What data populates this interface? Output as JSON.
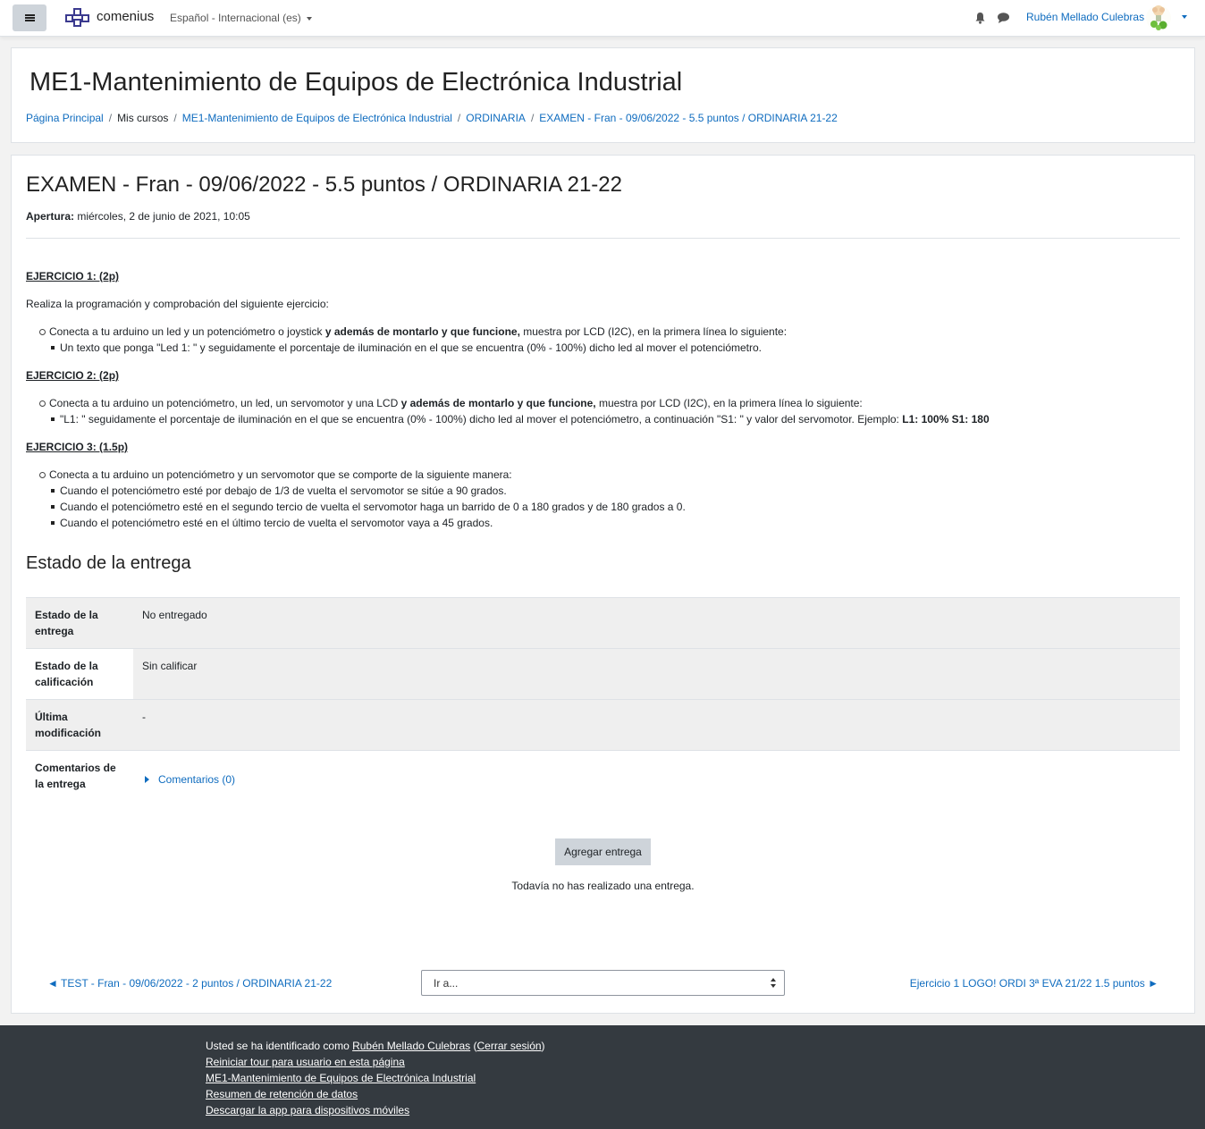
{
  "navbar": {
    "brand": "comenius",
    "language": "Español - Internacional (es)",
    "user_name": "Rubén Mellado Culebras"
  },
  "header": {
    "course_title": "ME1-Mantenimiento de Equipos de Electrónica Industrial",
    "breadcrumb": [
      "Página Principal",
      "Mis cursos",
      "ME1-Mantenimiento de Equipos de Electrónica Industrial",
      "ORDINARIA",
      "EXAMEN - Fran - 09/06/2022 - 5.5 puntos / ORDINARIA 21-22"
    ]
  },
  "assignment": {
    "title": "EXAMEN - Fran - 09/06/2022 - 5.5 puntos / ORDINARIA 21-22",
    "opening_label": "Apertura:",
    "opening_value": " miércoles, 2 de junio de 2021, 10:05",
    "ex1": {
      "heading_a": "EJERCICIO 1: ",
      "heading_b": "(2p)",
      "intro": "Realiza la programación y comprobación del siguiente ejercicio:",
      "item_a": "Conecta a tu arduino un led y un potenciómetro o joystick ",
      "item_b": "y además de montarlo y que funcione,",
      "item_c": " muestra por LCD (I2C), en la primera línea lo siguiente:",
      "sub1": "Un texto que ponga \"Led 1: \" y seguidamente el porcentaje de iluminación en el que se encuentra (0% - 100%) dicho led al mover el potenciómetro."
    },
    "ex2": {
      "heading_a": "EJERCICIO 2:  ",
      "heading_b": "(2p)",
      "item_a": "Conecta  a tu arduino un potenciómetro, un led, un servomotor y una LCD ",
      "item_b": "y además de montarlo y que funcione,",
      "item_c": " muestra por LCD (I2C), en la primera línea lo siguiente:",
      "sub1_a": "\"L1: \" seguidamente el porcentaje de iluminación en el que se encuentra (0% - 100%) dicho led al mover el potenciómetro, a continuación \"S1: \" y valor del servomotor. Ejemplo: ",
      "sub1_b": "L1: 100% S1: 180"
    },
    "ex3": {
      "heading_a": "EJERCICIO 3:  ",
      "heading_b": "(1.5p)",
      "item": "Conecta  a tu arduino un potenciómetro y un servomotor que se comporte de la siguiente manera:",
      "sub1": "Cuando el potenciómetro esté por debajo de 1/3 de vuelta el servomotor se sitúe a 90 grados.",
      "sub2": "Cuando el potenciómetro esté en el segundo tercio de vuelta el servomotor haga un barrido de 0 a 180 grados y de 180 grados a 0.",
      "sub3": "Cuando el potenciómetro esté en el último tercio de vuelta el servomotor vaya a 45 grados."
    }
  },
  "submission": {
    "heading": "Estado de la entrega",
    "rows": [
      {
        "label": "Estado de la entrega",
        "value": "No entregado"
      },
      {
        "label": "Estado de la calificación",
        "value": "Sin calificar"
      },
      {
        "label": "Última modificación",
        "value": "-"
      },
      {
        "label": "Comentarios de la entrega",
        "value": "Comentarios (0)"
      }
    ],
    "add_button": "Agregar entrega",
    "note": "Todavía no has realizado una entrega."
  },
  "navigation": {
    "prev": "◄ TEST - Fran - 09/06/2022 - 2 puntos / ORDINARIA 21-22",
    "jump_placeholder": "Ir a...",
    "next": "Ejercicio 1 LOGO! ORDI 3ª EVA 21/22 1.5 puntos ►"
  },
  "footer": {
    "logged_in_prefix": "Usted se ha identificado como ",
    "logged_in_user": "Rubén Mellado Culebras",
    "logout_open": " (",
    "logout": "Cerrar sesión",
    "logout_close": ")",
    "tour": "Reiniciar tour para usuario en esta página",
    "course": "ME1-Mantenimiento de Equipos de Electrónica Industrial",
    "retention": "Resumen de retención de datos",
    "app": "Descargar la app para dispositivos móviles"
  }
}
